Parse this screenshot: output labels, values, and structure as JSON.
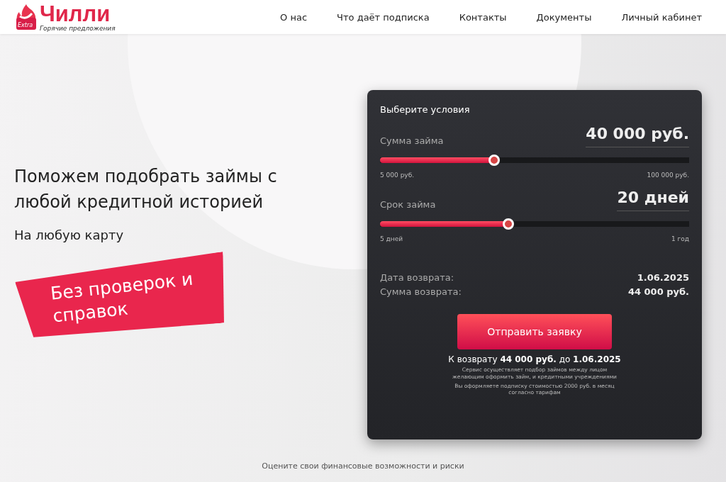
{
  "header": {
    "logo": {
      "name": "Чилли",
      "badge": "Extra",
      "tagline": "Горячие предложения"
    },
    "nav": [
      {
        "label": "О нас"
      },
      {
        "label": "Что даёт подписка"
      },
      {
        "label": "Контакты"
      },
      {
        "label": "Документы"
      },
      {
        "label": "Личный кабинет"
      }
    ]
  },
  "hero": {
    "title": "Поможем подобрать займы с любой кредитной историей",
    "subtitle": "На любую карту",
    "badge": "Без проверок и справок"
  },
  "calculator": {
    "title": "Выберите условия",
    "sliders": [
      {
        "label": "Сумма займа",
        "value": "40 000 руб.",
        "level": 0.37,
        "min": "5 000 руб.",
        "max": "100 000 руб."
      },
      {
        "label": "Срок займа",
        "value": "20 дней",
        "level": 0.415,
        "min": "5 дней",
        "max": "1 год"
      }
    ],
    "summary": [
      {
        "label": "Дата возврата:",
        "value": "1.06.2025"
      },
      {
        "label": "Сумма возврата:",
        "value": "44 000 руб."
      }
    ],
    "button": "Отправить заявку",
    "total": "К возврату **44 000 руб.** до **1.06.2025**",
    "notes": [
      "Сервис осуществляет подбор займов между лицом желающим оформить займ, и кредитными учреждениями",
      "Вы оформляете подписку стоимостью 2000 руб. в месяц согласно тарифам"
    ]
  },
  "footer_text": "Оцените свои финансовые возможности и риски"
}
